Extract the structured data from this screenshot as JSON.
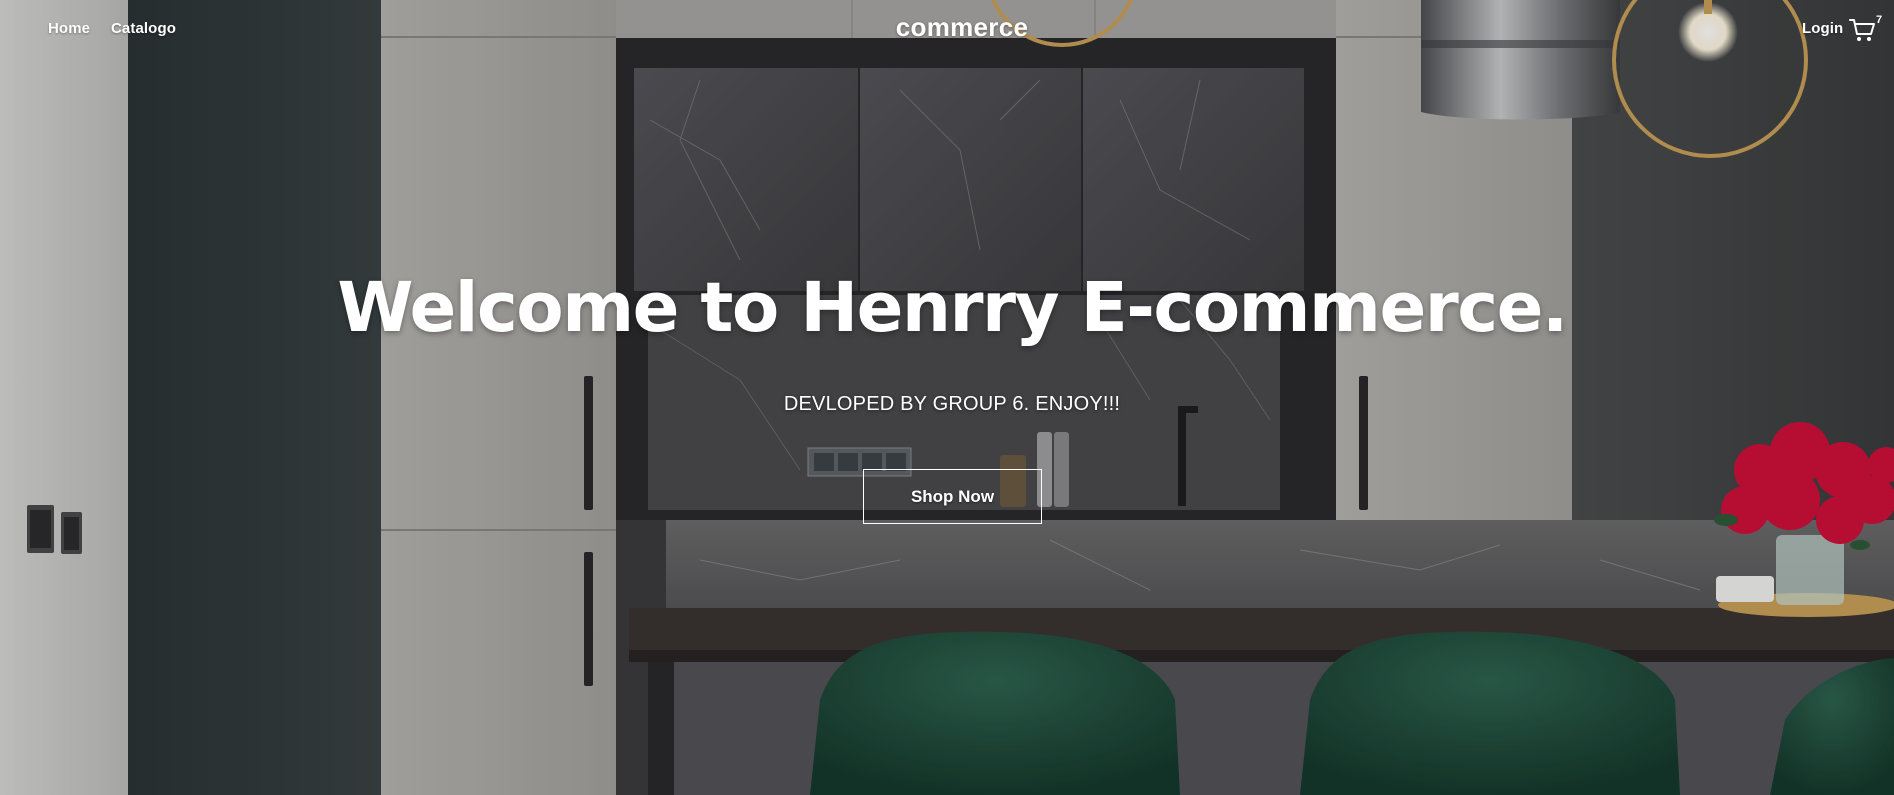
{
  "nav": {
    "home_label": "Home",
    "catalog_label": "Catalogo",
    "brand": "commerce",
    "login_label": "Login",
    "cart_count": "7"
  },
  "hero": {
    "headline": "Welcome to Henrry E-commerce.",
    "subtitle": "DEVLOPED BY GROUP 6. ENJOY!!!",
    "cta_label": "Shop Now",
    "background_image": "kitchen-interior-photo"
  },
  "icons": {
    "cart": "cart-icon"
  },
  "colors": {
    "text": "#ffffff",
    "cabinet_light": "#b8b6b2",
    "stone": "#4a4a4c",
    "chairs": "#1f4a3a",
    "flowers": "#d0103a",
    "brass": "#c9a05a"
  }
}
